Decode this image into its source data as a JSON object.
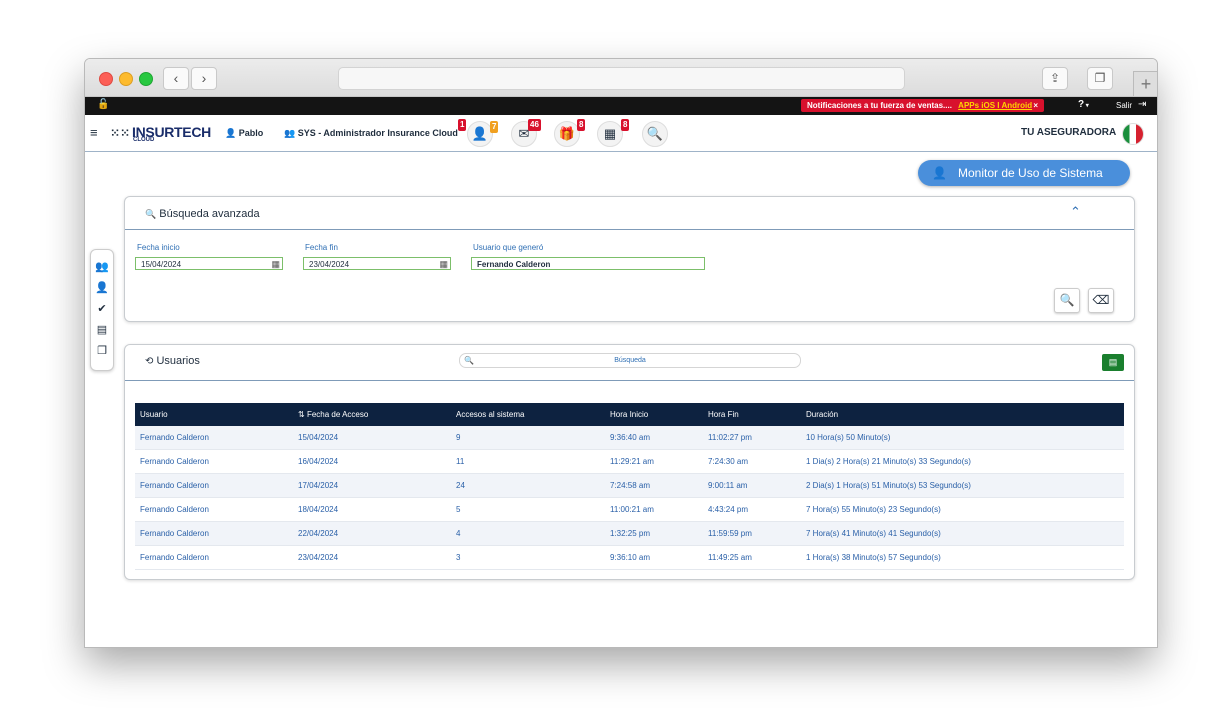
{
  "topbar": {
    "notification_text": "Notificaciones a tu fuerza de ventas....",
    "notification_link": "APPs iOS I Android",
    "notification_close": "×",
    "help_icon": "?",
    "logout_label": "Salir"
  },
  "header": {
    "logo_text": "INSURTECH",
    "logo_sub": "CLOUD",
    "user_name": "Pablo",
    "role": "SYS - Administrador Insurance Cloud",
    "badges": {
      "users_red": "1",
      "users_orange": "7",
      "mail": "46",
      "gift": "8",
      "calendar": "8"
    },
    "company": "TU ASEGURADORA"
  },
  "monitor_button": "Monitor de Uso de Sistema",
  "advanced_search": {
    "title": "Búsqueda avanzada",
    "fecha_inicio_label": "Fecha inicio",
    "fecha_inicio_value": "15/04/2024",
    "fecha_fin_label": "Fecha fin",
    "fecha_fin_value": "23/04/2024",
    "usuario_label": "Usuario que generó",
    "usuario_value": "Fernando Calderon"
  },
  "users_panel": {
    "title": "Usuarios",
    "search_placeholder": "Búsqueda",
    "columns": [
      "Usuario",
      "Fecha de Acceso",
      "Accesos al sistema",
      "Hora Inicio",
      "Hora Fin",
      "Duración"
    ],
    "rows": [
      [
        "Fernando Calderon",
        "15/04/2024",
        "9",
        "9:36:40 am",
        "11:02:27 pm",
        "10 Hora(s) 50 Minuto(s)"
      ],
      [
        "Fernando Calderon",
        "16/04/2024",
        "11",
        "11:29:21 am",
        "7:24:30 am",
        "1 Dia(s) 2 Hora(s) 21 Minuto(s) 33 Segundo(s)"
      ],
      [
        "Fernando Calderon",
        "17/04/2024",
        "24",
        "7:24:58 am",
        "9:00:11 am",
        "2 Dia(s) 1 Hora(s) 51 Minuto(s) 53 Segundo(s)"
      ],
      [
        "Fernando Calderon",
        "18/04/2024",
        "5",
        "11:00:21 am",
        "4:43:24 pm",
        "7 Hora(s) 55 Minuto(s) 23 Segundo(s)"
      ],
      [
        "Fernando Calderon",
        "22/04/2024",
        "4",
        "1:32:25 pm",
        "11:59:59 pm",
        "7 Hora(s) 41 Minuto(s) 41 Segundo(s)"
      ],
      [
        "Fernando Calderon",
        "23/04/2024",
        "3",
        "9:36:10 am",
        "11:49:25 am",
        "1 Hora(s) 38 Minuto(s) 57 Segundo(s)"
      ]
    ]
  }
}
